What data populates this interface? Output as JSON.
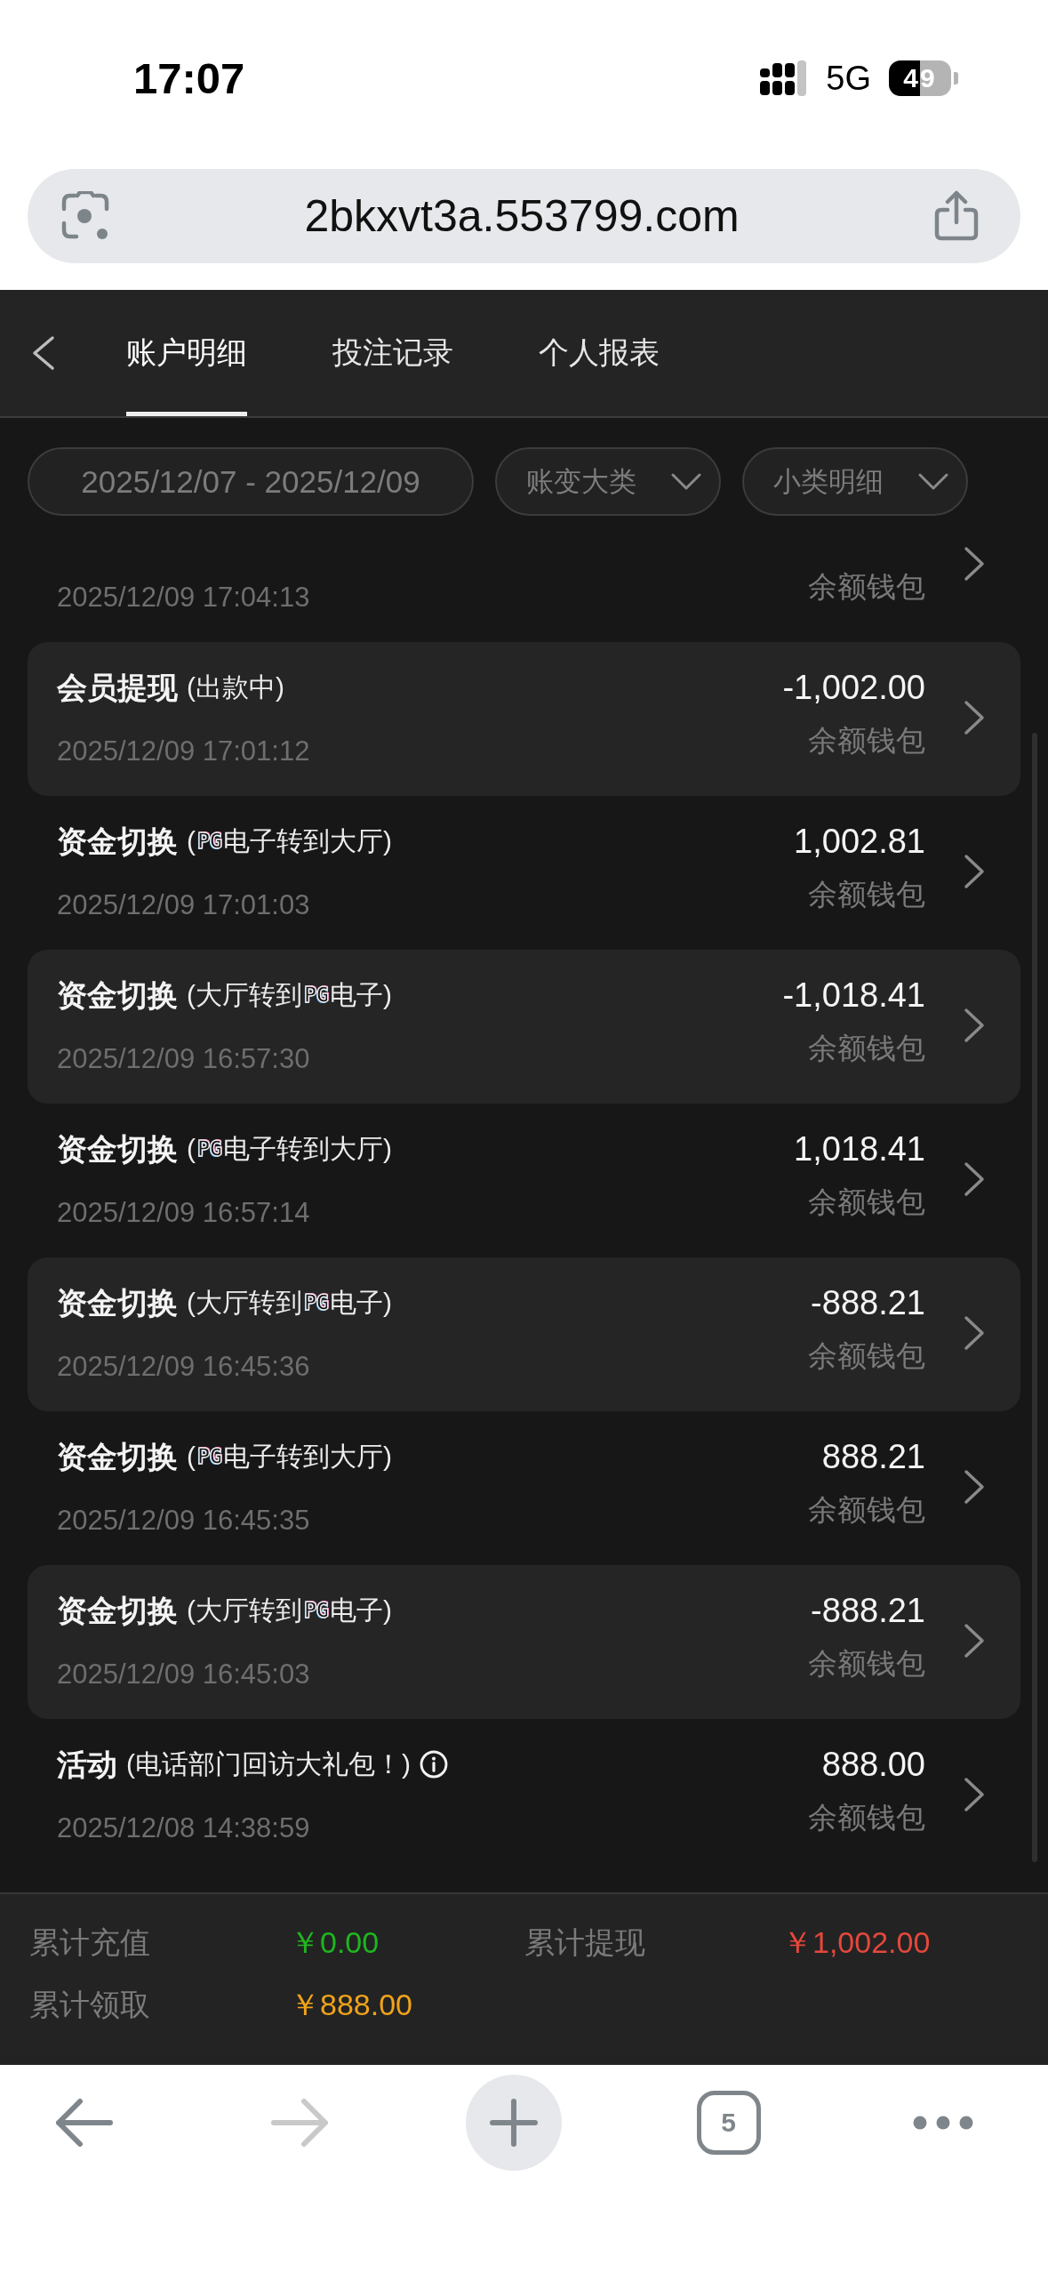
{
  "status_bar": {
    "time": "17:07",
    "network": "5G",
    "battery": "49"
  },
  "address_bar": {
    "url": "2bkxvt3a.553799.com"
  },
  "tabs": [
    {
      "label": "账户明细",
      "selected": true
    },
    {
      "label": "投注记录",
      "selected": false
    },
    {
      "label": "个人报表",
      "selected": false
    }
  ],
  "filters": {
    "date_range": "2025/12/07 - 2025/12/09",
    "dropdowns": [
      "账变大类",
      "小类明细"
    ]
  },
  "transactions": [
    {
      "time": "2025/12/09 17:04:13",
      "wallet": "余额钱包"
    },
    {
      "category": "会员提现",
      "detail": [
        {
          "kind": "text",
          "text": "(出款中)"
        }
      ],
      "amount": "-1,002.00",
      "time": "2025/12/09 17:01:12",
      "wallet": "余额钱包"
    },
    {
      "category": "资金切换",
      "detail": [
        {
          "kind": "text",
          "text": "("
        },
        {
          "kind": "logo",
          "text": "PG"
        },
        {
          "kind": "text",
          "text": "电子转到大厅)"
        }
      ],
      "amount": "1,002.81",
      "time": "2025/12/09 17:01:03",
      "wallet": "余额钱包"
    },
    {
      "category": "资金切换",
      "detail": [
        {
          "kind": "text",
          "text": "(大厅转到"
        },
        {
          "kind": "logo",
          "text": "PG"
        },
        {
          "kind": "text",
          "text": "电子)"
        }
      ],
      "amount": "-1,018.41",
      "time": "2025/12/09 16:57:30",
      "wallet": "余额钱包"
    },
    {
      "category": "资金切换",
      "detail": [
        {
          "kind": "text",
          "text": "("
        },
        {
          "kind": "logo",
          "text": "PG"
        },
        {
          "kind": "text",
          "text": "电子转到大厅)"
        }
      ],
      "amount": "1,018.41",
      "time": "2025/12/09 16:57:14",
      "wallet": "余额钱包"
    },
    {
      "category": "资金切换",
      "detail": [
        {
          "kind": "text",
          "text": "(大厅转到"
        },
        {
          "kind": "logo",
          "text": "PG"
        },
        {
          "kind": "text",
          "text": "电子)"
        }
      ],
      "amount": "-888.21",
      "time": "2025/12/09 16:45:36",
      "wallet": "余额钱包"
    },
    {
      "category": "资金切换",
      "detail": [
        {
          "kind": "text",
          "text": "("
        },
        {
          "kind": "logo",
          "text": "PG"
        },
        {
          "kind": "text",
          "text": "电子转到大厅)"
        }
      ],
      "amount": "888.21",
      "time": "2025/12/09 16:45:35",
      "wallet": "余额钱包"
    },
    {
      "category": "资金切换",
      "detail": [
        {
          "kind": "text",
          "text": "(大厅转到"
        },
        {
          "kind": "logo",
          "text": "PG"
        },
        {
          "kind": "text",
          "text": "电子)"
        }
      ],
      "amount": "-888.21",
      "time": "2025/12/09 16:45:03",
      "wallet": "余额钱包"
    },
    {
      "category": "活动",
      "detail": [
        {
          "kind": "text",
          "text": "(电话部门回访大礼包！)"
        }
      ],
      "info": true,
      "amount": "888.00",
      "time": "2025/12/08 14:38:59",
      "wallet": "余额钱包"
    }
  ],
  "summary": [
    {
      "label": "累计充值",
      "value": "￥0.00",
      "color": "#1fb51f"
    },
    {
      "label": "累计提现",
      "value": "￥1,002.00",
      "color": "#e5473c"
    },
    {
      "label": "累计领取",
      "value": "￥888.00",
      "color": "#f0a31a"
    }
  ],
  "browser_toolbar": {
    "buttons": [
      {
        "kind": "back",
        "disabled": false
      },
      {
        "kind": "forward",
        "disabled": true
      },
      {
        "kind": "new_tab",
        "disabled": false
      },
      {
        "kind": "tabs",
        "count": "5",
        "disabled": false
      },
      {
        "kind": "more",
        "disabled": false
      }
    ]
  }
}
